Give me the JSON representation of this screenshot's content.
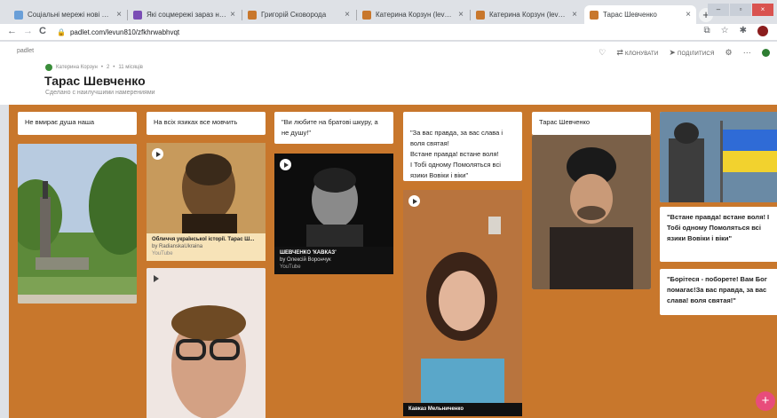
{
  "browser": {
    "tabs": [
      {
        "title": "Соціальні мережі нові можли",
        "color": "#6a9fd8"
      },
      {
        "title": "Які соцмережі зараз найпопул",
        "color": "#7a4db5"
      },
      {
        "title": "Григорій Сковорода",
        "color": "#c8772c"
      },
      {
        "title": "Катерина Корзун (levun810)",
        "color": "#c8772c"
      },
      {
        "title": "Катерина Корзун (levun810)",
        "color": "#c8772c"
      },
      {
        "title": "Тарас Шевченко",
        "color": "#c8772c"
      }
    ],
    "close_glyph": "×",
    "new_tab_glyph": "+",
    "url": "padlet.com/levun810/zfkhrwabhvqt",
    "nav": {
      "back": "←",
      "forward": "→",
      "reload": "C"
    },
    "toolbar_icons": [
      "cast-icon",
      "star-icon",
      "extensions-icon",
      "profile-icon"
    ]
  },
  "padlet": {
    "brand": "padlet",
    "author": "Катерина Корзун",
    "dot": "•",
    "likes": "2",
    "time_ago": "11 місяців",
    "title": "Тарас Шевченко",
    "subtitle": "Сделано с наилучшими намерениями",
    "actions": {
      "clone": "КЛОНУВАТИ",
      "share": "ПОДІЛИТИСЯ"
    },
    "accent": "#c8772c",
    "fab_color": "#e84c7b",
    "fab_label": "+"
  },
  "wall": {
    "columns": [
      {
        "heading": "Не вмирає душа наша"
      },
      {
        "heading": "На всіх язиках все мовчить",
        "video": {
          "title": "Обличчя української історії. Тарас Ш...",
          "channel": "by RadianskaUkraina",
          "source": "YouTube"
        }
      },
      {
        "heading": "\"Ви любите на братові шкуру, а не душу!\"",
        "video": {
          "title": "ШЕВЧЕНКО 'КАВКАЗ'",
          "channel": "by Олексій Ворончук",
          "source": "YouTube"
        }
      },
      {
        "heading": "\"За вас правда, за вас слава і воля святая!\nВстане правда! встане воля!\nІ Тобі одному Помоляться всі язики Вовіки і віки\"",
        "video": {
          "title": "Кавказ Мельниченко"
        }
      },
      {
        "heading": "Тарас Шевченко"
      },
      {
        "quote1": "\"Встане правда! встане воля! І Тобі одному Помоляться всі язики Вовіки і віки\"",
        "quote2": "\"Борітеся - поборете! Вам Бог помагає!За вас правда, за вас слава! воля святая!\""
      }
    ]
  }
}
